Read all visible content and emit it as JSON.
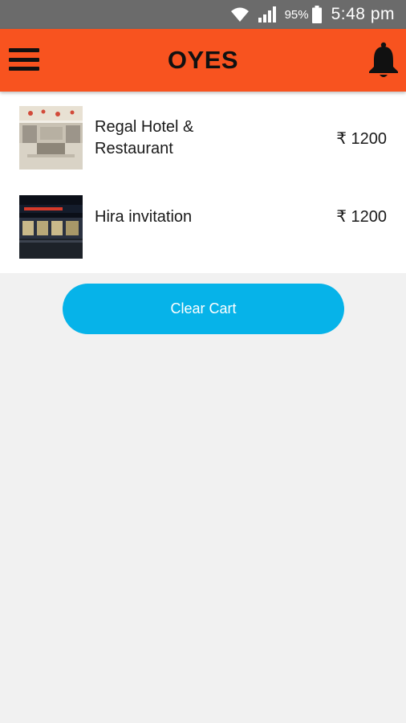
{
  "status_bar": {
    "battery_percent": "95%",
    "time": "5:48 pm",
    "icons": [
      "wifi-icon",
      "signal-icon",
      "battery-icon"
    ]
  },
  "app_bar": {
    "title": "OYES",
    "left_icon": "menu-icon",
    "right_icon": "bell-icon"
  },
  "cart": {
    "items": [
      {
        "name": "Regal Hotel & Restaurant",
        "price": "₹ 1200",
        "image": "hotel-interior-thumbnail"
      },
      {
        "name": "Hira invitation",
        "price": "₹ 1200",
        "image": "restaurant-night-thumbnail"
      }
    ],
    "clear_label": "Clear Cart"
  },
  "colors": {
    "status_bar": "#6b6b6b",
    "app_bar": "#f8531f",
    "clear_button": "#06b3e9",
    "background": "#f1f1f1"
  }
}
